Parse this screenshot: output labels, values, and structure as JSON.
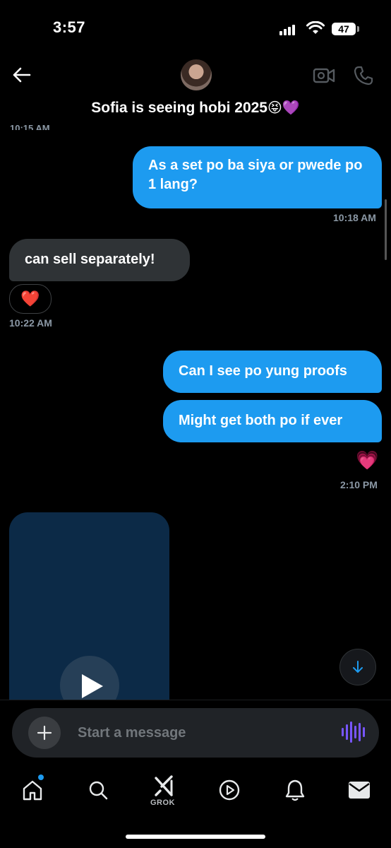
{
  "status_bar": {
    "time": "3:57",
    "battery": "47"
  },
  "header": {
    "title": "Sofia is seeing hobi 2025",
    "title_emojis": "😝💜"
  },
  "messages": [
    {
      "direction": "in",
      "partial_timestamp": "10:15 AM"
    },
    {
      "direction": "out",
      "text": "As a set po ba siya or pwede po 1 lang?",
      "timestamp": "10:18 AM"
    },
    {
      "direction": "in",
      "text": "can sell separately!",
      "reaction": "❤️",
      "timestamp": "10:22 AM"
    },
    {
      "direction": "out",
      "text": "Can I see po yung proofs"
    },
    {
      "direction": "out",
      "text": "Might get both po if ever",
      "reaction": "💗",
      "timestamp": "2:10 PM"
    },
    {
      "direction": "in",
      "type": "video"
    }
  ],
  "composer": {
    "placeholder": "Start a message"
  },
  "tab_bar": {
    "items": [
      "home-icon",
      "search-icon",
      "grok-icon",
      "video-icon",
      "notifications-icon",
      "messages-icon"
    ],
    "grok_label": "GROK"
  },
  "colors": {
    "accent": "#1d9bf0",
    "incoming_bubble": "#2f3336",
    "voice": "#7856ff"
  }
}
